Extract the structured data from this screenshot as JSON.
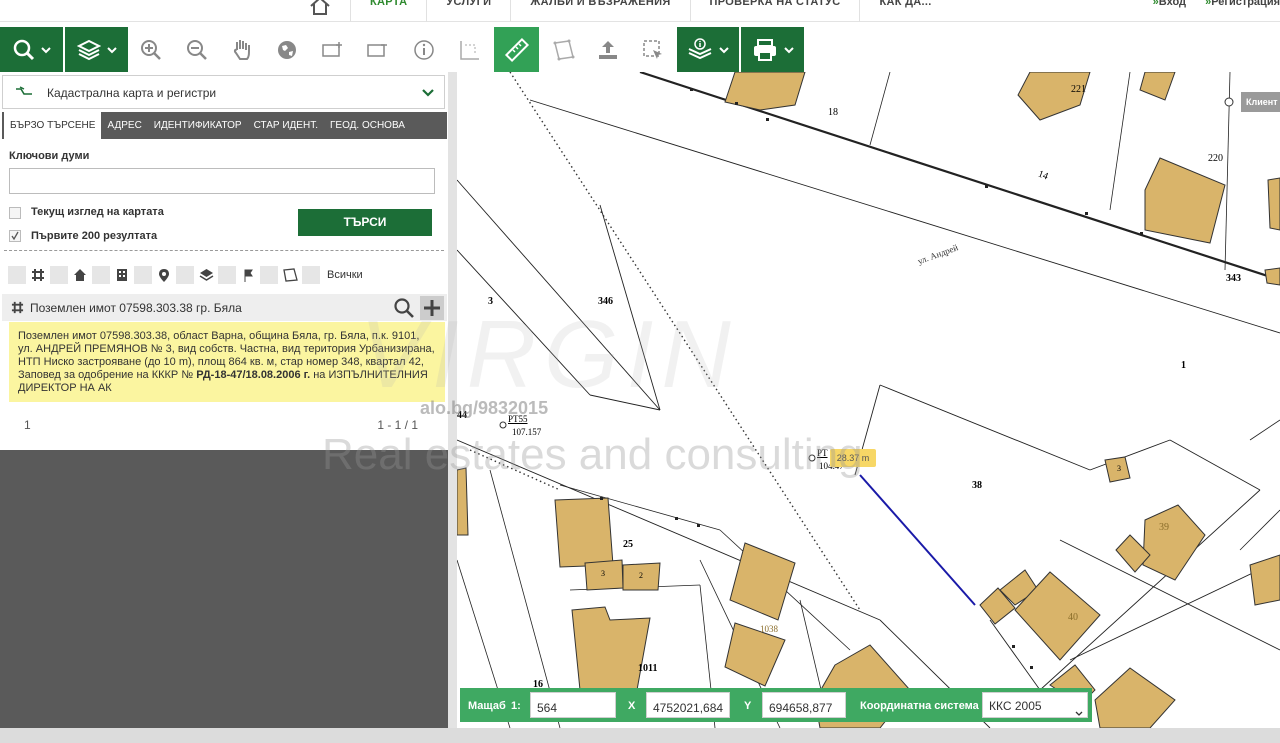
{
  "topnav": {
    "items": [
      {
        "label": "КАРТА"
      },
      {
        "label": "УСЛУГИ"
      },
      {
        "label": "ЖАЛБИ И ВЪЗРАЖЕНИЯ"
      },
      {
        "label": "ПРОВЕРКА НА СТАТУС"
      },
      {
        "label": "КАК ДА..."
      }
    ],
    "login": "Вход",
    "register": "Регистрация"
  },
  "panel": {
    "layer_title": "Кадастрална карта и регистри",
    "tabs": [
      {
        "label": "БЪРЗО ТЪРСЕНЕ"
      },
      {
        "label": "АДРЕС"
      },
      {
        "label": "ИДЕНТИФИКАТОР"
      },
      {
        "label": "СТАР ИДЕНТ."
      },
      {
        "label": "ГЕОД. ОСНОВА"
      }
    ],
    "keywords_label": "Ключови думи",
    "keywords_value": "",
    "current_view_label": "Текущ изглед на картата",
    "first200_label": "Първите 200 резултата",
    "search_button": "ТЪРСИ",
    "filter_all": "Всички",
    "result_title": "Поземлен имот 07598.303.38 гр. Бяла",
    "result_text_1": "Поземлен имот 07598.303.38, област Варна, община Бяла, гр. Бяла, п.к. 9101, ул. АНДРЕЙ ПРЕМЯНОВ № 3, вид собств. Частна, вид територия Урбанизирана, НТП Ниско застрояване (до 10 m), площ 864 кв. м, стар номер 348, квартал 42, Заповед за одобрение на КККР № ",
    "result_text_bold": "РД-18-47/18.08.2006 г.",
    "result_text_2": " на ИЗПЪЛНИТЕЛНИЯ ДИРЕКТОР НА АК",
    "page": "1",
    "range": "1 - 1 / 1"
  },
  "statusbar": {
    "scale_label": "Мащаб",
    "scale_prefix": "1:",
    "scale_value": "564",
    "x_label": "X",
    "x_value": "4752021,684",
    "y_label": "Y",
    "y_value": "694658,877",
    "crs_label": "Координатна система",
    "crs_value": "ККС 2005"
  },
  "map": {
    "labels": [
      "18",
      "221",
      "220",
      "14",
      "343",
      "3",
      "346",
      "1",
      "44",
      "38",
      "25",
      "3",
      "2",
      "1011",
      "16",
      "1038",
      "39",
      "40",
      "3"
    ],
    "pt55_label": "PT55",
    "pt55_value": "107.157",
    "pt2_label": "PT",
    "pt2_value": "104.47",
    "measure": "28.37 m",
    "tooltip": "Клиент"
  },
  "watermark": {
    "site": "alo.bg/9832015",
    "brand": "VIRGIN",
    "tagline": "Real estates and consulting"
  },
  "colors": {
    "toolbar_dark": "#1c6e37",
    "toolbar_active": "#32a156",
    "statusbar": "#3fa962",
    "building": "#d9b46a",
    "highlight": "#fbf5a0"
  }
}
